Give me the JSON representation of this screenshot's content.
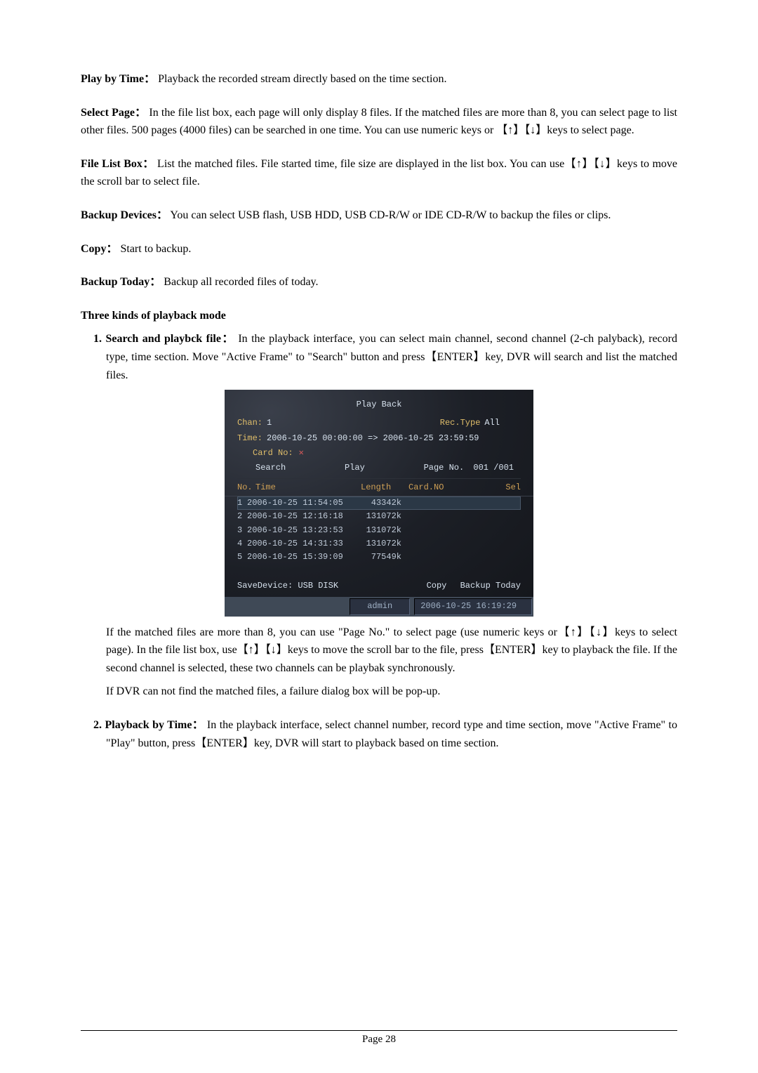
{
  "p_play_by_time_label": "Play by Time：",
  "p_play_by_time_text": "Playback the recorded stream directly based on the time section.",
  "p_select_page_label": "Select Page：",
  "p_select_page_text": "In the file list box, each page will only display 8 files. If the matched files are more than 8, you can select page to list other files. 500 pages (4000 files) can be searched in one time. You can use numeric keys or  【↑】【↓】keys to select page.",
  "p_file_list_label": "File List Box：",
  "p_file_list_text": "List the matched files. File started time, file size are displayed in the list box. You can use【↑】【↓】keys to move the scroll bar to select file.",
  "p_backup_dev_label": "Backup Devices：",
  "p_backup_dev_text": "You can select USB flash, USB HDD, USB CD-R/W or IDE CD-R/W to backup the files or clips.",
  "p_copy_label": "Copy：",
  "p_copy_text": "Start to backup.",
  "p_backup_today_label": "Backup Today：",
  "p_backup_today_text": "Backup all recorded files of today.",
  "heading_three_kinds": "Three kinds of playback mode",
  "item1_label": "1. Search and playbck file：",
  "item1_text": "In the playback interface, you can select main channel, second channel (2-ch palyback), record type, time section. Move \"Active Frame\" to \"Search\" button and press【ENTER】key, DVR will search and list the matched files.",
  "after_ss_para1": "If the matched files are more than 8, you can use \"Page No.\" to select page (use numeric keys or【↑】【↓】keys to select page). In the file list box, use【↑】【↓】keys to move the scroll bar to the file, press【ENTER】key to playback the file. If the second channel is selected, these two channels can be playbak synchronously.",
  "after_ss_para2": "If DVR can not find the matched files, a failure dialog box will be pop-up.",
  "item2_label": "2. Playback by Time：",
  "item2_text": "In the playback interface, select channel number, record type and time section, move \"Active Frame\" to \"Play\" button, press【ENTER】key, DVR will start to playback based on time section.",
  "footer": "Page 28",
  "ss": {
    "title": "Play Back",
    "chan_label": "Chan:",
    "chan_value": "1",
    "rectype_label": "Rec.Type",
    "rectype_value": "All",
    "time_label": "Time:",
    "time_range": "2006-10-25 00:00:00 => 2006-10-25 23:59:59",
    "cardno_label": "Card No:",
    "search_btn": "Search",
    "play_btn": "Play",
    "pageno_label": "Page No.",
    "pageno_cur": "001",
    "pageno_total": "/001",
    "headers": {
      "no": "No.",
      "time": "Time",
      "length": "Length",
      "card": "Card.NO",
      "sel": "Sel"
    },
    "rows": [
      {
        "no": "1",
        "time": "2006-10-25 11:54:05",
        "len": "43342k"
      },
      {
        "no": "2",
        "time": "2006-10-25 12:16:18",
        "len": "131072k"
      },
      {
        "no": "3",
        "time": "2006-10-25 13:23:53",
        "len": "131072k"
      },
      {
        "no": "4",
        "time": "2006-10-25 14:31:33",
        "len": "131072k"
      },
      {
        "no": "5",
        "time": "2006-10-25 15:39:09",
        "len": "77549k"
      }
    ],
    "savedev_label": "SaveDevice:",
    "savedev_value": "USB DISK",
    "copy_btn": "Copy",
    "backup_today_btn": "Backup Today",
    "status_user": "admin",
    "status_time": "2006-10-25 16:19:29"
  }
}
